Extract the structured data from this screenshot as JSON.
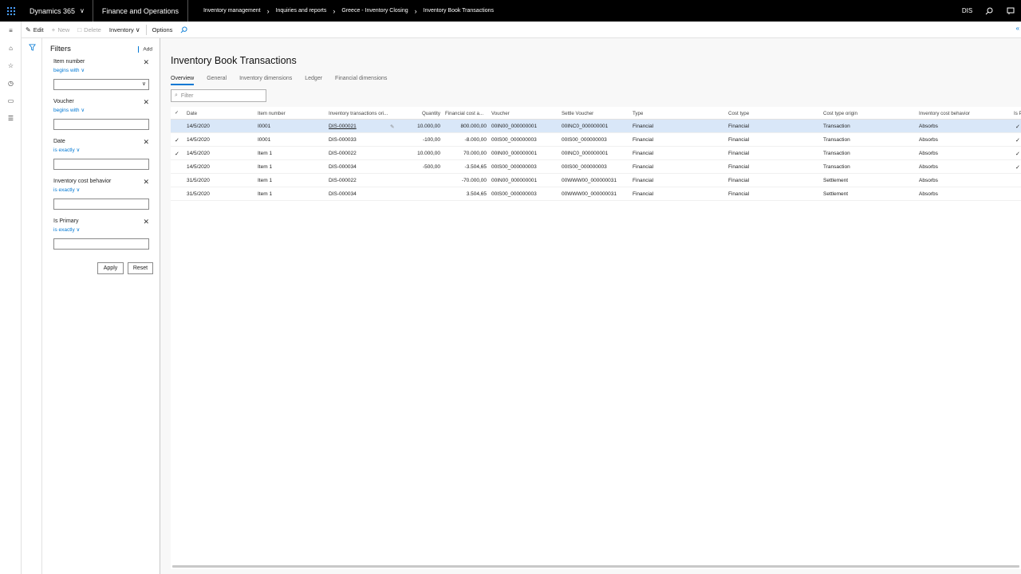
{
  "topbar": {
    "brand": "Dynamics 365",
    "module": "Finance and Operations",
    "breadcrumbs": [
      "Inventory management",
      "Inquiries and reports",
      "Greece - Inventory Closing",
      "Inventory Book Transactions"
    ],
    "company": "DIS"
  },
  "actionbar": {
    "edit": "Edit",
    "new": "New",
    "delete": "Delete",
    "inventory": "Inventory",
    "options": "Options"
  },
  "filters": {
    "title": "Filters",
    "add": "Add",
    "groups": [
      {
        "label": "Item number",
        "operator": "begins with",
        "value": ""
      },
      {
        "label": "Voucher",
        "operator": "begins with",
        "value": ""
      },
      {
        "label": "Date",
        "operator": "is exactly",
        "value": ""
      },
      {
        "label": "Inventory cost behavior",
        "operator": "is exactly",
        "value": ""
      },
      {
        "label": "Is Primary",
        "operator": "is exactly",
        "value": ""
      }
    ],
    "apply": "Apply",
    "reset": "Reset"
  },
  "main": {
    "title": "Inventory Book Transactions",
    "tabs": [
      "Overview",
      "General",
      "Inventory dimensions",
      "Ledger",
      "Financial dimensions"
    ],
    "filter_placeholder": "Filter"
  },
  "grid": {
    "columns": [
      "Date",
      "Item number",
      "Inventory transactions ori...",
      "Quantity",
      "Financial cost a...",
      "Voucher",
      "Settle Voucher",
      "Type",
      "Cost type",
      "Cost type origin",
      "Inventory cost behavior",
      "Is P"
    ],
    "rows": [
      {
        "date": "14/5/2020",
        "item": "I0001",
        "origin": "DIS-000021",
        "qty": "10.000,00",
        "cost": "800.000,00",
        "voucher": "00IN00_000000001",
        "settle": "00INC0_000000001",
        "type": "Financial",
        "costtype": "Financial",
        "origintype": "Transaction",
        "behavior": "Absorbs",
        "primary": true
      },
      {
        "date": "14/5/2020",
        "item": "I0001",
        "origin": "DIS-000033",
        "qty": "-100,00",
        "cost": "-8.000,00",
        "voucher": "00IS00_000000003",
        "settle": "00IS00_000000003",
        "type": "Financial",
        "costtype": "Financial",
        "origintype": "Transaction",
        "behavior": "Absorbs",
        "primary": true
      },
      {
        "date": "14/5/2020",
        "item": "Item 1",
        "origin": "DIS-000022",
        "qty": "10.000,00",
        "cost": "70.000,00",
        "voucher": "00IN00_000000001",
        "settle": "00INC0_000000001",
        "type": "Financial",
        "costtype": "Financial",
        "origintype": "Transaction",
        "behavior": "Absorbs",
        "primary": true
      },
      {
        "date": "14/5/2020",
        "item": "Item 1",
        "origin": "DIS-000034",
        "qty": "-500,00",
        "cost": "-3.504,65",
        "voucher": "00IS00_000000003",
        "settle": "00IS00_000000003",
        "type": "Financial",
        "costtype": "Financial",
        "origintype": "Transaction",
        "behavior": "Absorbs",
        "primary": true
      },
      {
        "date": "31/5/2020",
        "item": "Item 1",
        "origin": "DIS-000022",
        "qty": "",
        "cost": "-70.000,00",
        "voucher": "00IN00_000000001",
        "settle": "00WWW00_000000031",
        "type": "Financial",
        "costtype": "Financial",
        "origintype": "Settlement",
        "behavior": "Absorbs",
        "primary": false
      },
      {
        "date": "31/5/2020",
        "item": "Item 1",
        "origin": "DIS-000034",
        "qty": "",
        "cost": "3.504,65",
        "voucher": "00IS00_000000003",
        "settle": "00WWW00_000000031",
        "type": "Financial",
        "costtype": "Financial",
        "origintype": "Settlement",
        "behavior": "Absorbs",
        "primary": false
      }
    ]
  }
}
